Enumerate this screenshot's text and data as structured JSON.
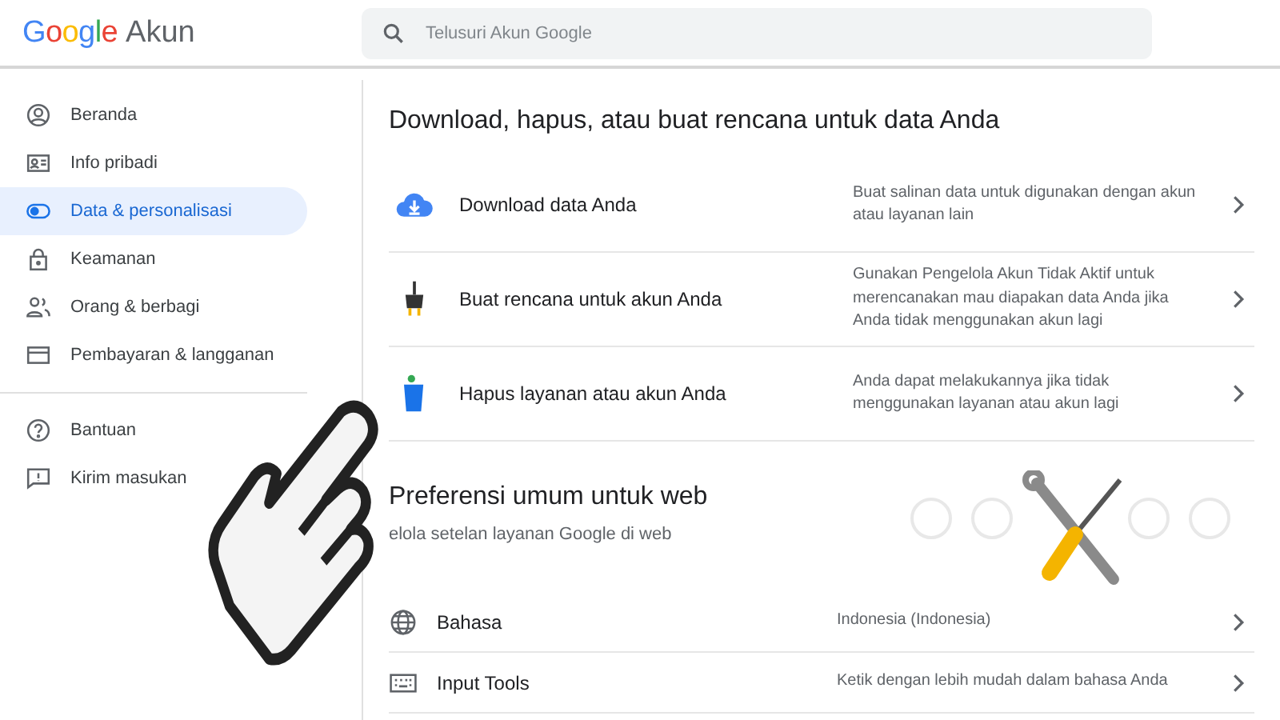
{
  "header": {
    "logo": "Google",
    "product": "Akun",
    "search": {
      "placeholder": "Telusuri Akun Google"
    }
  },
  "sidebar": {
    "items": [
      {
        "label": "Beranda",
        "selected": false
      },
      {
        "label": "Info pribadi",
        "selected": false
      },
      {
        "label": "Data & personalisasi",
        "selected": true
      },
      {
        "label": "Keamanan",
        "selected": false
      },
      {
        "label": "Orang & berbagi",
        "selected": false
      },
      {
        "label": "Pembayaran & langganan",
        "selected": false
      }
    ],
    "footer_items": [
      {
        "label": "Bantuan"
      },
      {
        "label": "Kirim masukan"
      }
    ]
  },
  "sections": [
    {
      "title": "Download, hapus, atau buat rencana untuk data Anda",
      "rows": [
        {
          "label": "Download data Anda",
          "description": "Buat salinan data untuk digunakan dengan akun atau layanan lain"
        },
        {
          "label": "Buat rencana untuk akun Anda",
          "description": "Gunakan Pengelola Akun Tidak Aktif untuk merencanakan mau diapakan data Anda jika Anda tidak menggunakan akun lagi"
        },
        {
          "label": "Hapus layanan atau akun Anda",
          "description": "Anda dapat melakukannya jika tidak menggunakan layanan atau akun lagi"
        }
      ]
    },
    {
      "title": "Preferensi umum untuk web",
      "subtitle": "elola setelan layanan Google di web",
      "rows": [
        {
          "label": "Bahasa",
          "description": "Indonesia (Indonesia)"
        },
        {
          "label": "Input Tools",
          "description": "Ketik dengan lebih mudah dalam bahasa Anda"
        }
      ]
    }
  ]
}
